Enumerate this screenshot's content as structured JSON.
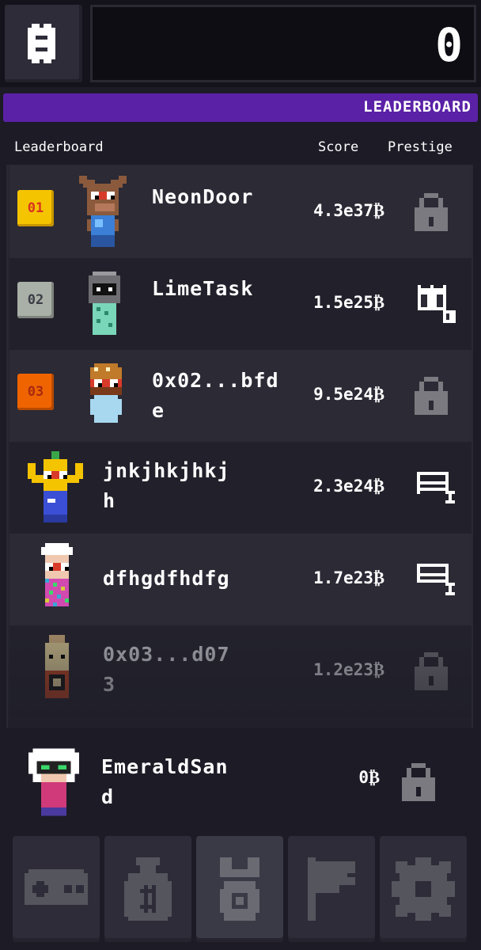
{
  "header": {
    "currency_icon": "bitcoin-coin-icon",
    "score": "0"
  },
  "banner": {
    "title": "LEADERBOARD"
  },
  "columns": {
    "leaderboard": "Leaderboard",
    "score": "Score",
    "prestige": "Prestige"
  },
  "rows": [
    {
      "rank": "01",
      "name": "NeonDoor",
      "score": "4.3e37₿",
      "prestige": "lock-icon"
    },
    {
      "rank": "02",
      "name": "LimeTask",
      "score": "1.5e25₿",
      "prestige": "castle-tier-2-icon"
    },
    {
      "rank": "03",
      "name": "0x02...bfde",
      "score": "9.5e24₿",
      "prestige": "lock-icon"
    },
    {
      "rank": "",
      "name": "jnkjhkjhkjh",
      "score": "2.3e24₿",
      "prestige": "bed-tier-1-icon"
    },
    {
      "rank": "",
      "name": "dfhgdfhdfg",
      "score": "1.7e23₿",
      "prestige": "bed-tier-1-icon"
    },
    {
      "rank": "",
      "name": "0x03...d073",
      "score": "1.2e23₿",
      "prestige": "lock-icon"
    }
  ],
  "self": {
    "name": "EmeraldSand",
    "score": "0₿",
    "prestige": "lock-icon"
  },
  "nav": [
    {
      "name": "game",
      "icon": "gamepad-icon"
    },
    {
      "name": "bag",
      "icon": "money-bag-icon"
    },
    {
      "name": "leaderboard",
      "icon": "medal-icon",
      "active": true
    },
    {
      "name": "quests",
      "icon": "flag-icon"
    },
    {
      "name": "settings",
      "icon": "gear-icon"
    }
  ],
  "colors": {
    "banner": "#5a21a6",
    "rank_gold": "#f5c400",
    "rank_silver": "#a9b0a8",
    "rank_bronze": "#f06400",
    "rank_text": "#d8341e"
  }
}
